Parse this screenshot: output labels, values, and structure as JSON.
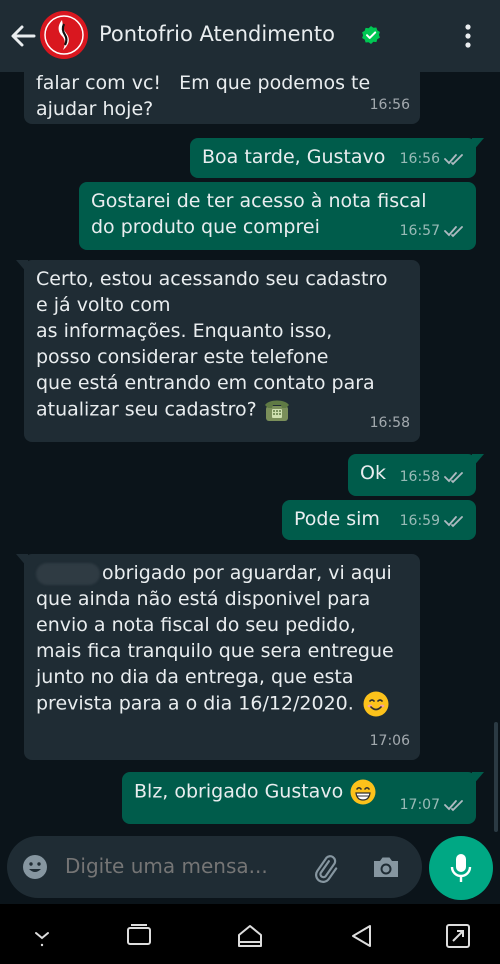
{
  "header": {
    "title": "Pontofrio Atendimento",
    "back_icon": "arrow-left-icon",
    "verified_icon": "verified-check-icon",
    "menu_icon": "kebab-menu-icon",
    "accent": "#00a884"
  },
  "messages": [
    {
      "dir": "in",
      "text": "falar com vc!   Em que podemos te\najudar hoje?",
      "time": "16:56"
    },
    {
      "dir": "out",
      "text": "Boa tarde, Gustavo",
      "time": "16:56"
    },
    {
      "dir": "out",
      "text": "Gostarei de ter acesso à nota fiscal\ndo produto que comprei",
      "time": "16:57"
    },
    {
      "dir": "in",
      "text": "Certo, estou acessando seu cadastro\ne já volto com\nas informações. Enquanto isso,\nposso considerar este telefone\nque está entrando em contato para\natualizar seu cadastro?",
      "time": "16:58",
      "emoji": "telephone-emoji"
    },
    {
      "dir": "out",
      "text": "Ok",
      "time": "16:58"
    },
    {
      "dir": "out",
      "text": "Pode sim",
      "time": "16:59"
    },
    {
      "dir": "in",
      "text_first": "obrigado por aguardar, vi aqui",
      "text": "que ainda não está disponivel para\nenvio a nota fiscal do seu pedido,\nmais fica tranquilo que sera entregue\njunto no dia da entrega, que esta\nprevista para a o dia 16/12/2020.",
      "time": "17:06",
      "emoji": "smiling-face-emoji"
    },
    {
      "dir": "out",
      "text": "Blz, obrigado Gustavo",
      "time": "17:07",
      "emoji": "grinning-face-emoji"
    }
  ],
  "composer": {
    "placeholder": "Digite uma mensa...",
    "emoji_icon": "emoji-icon",
    "attach_icon": "paperclip-icon",
    "camera_icon": "camera-icon",
    "mic_icon": "microphone-icon"
  },
  "colors": {
    "incoming_bubble": "#1f2c34",
    "outgoing_bubble": "#005c4b",
    "background": "#0b141a"
  }
}
